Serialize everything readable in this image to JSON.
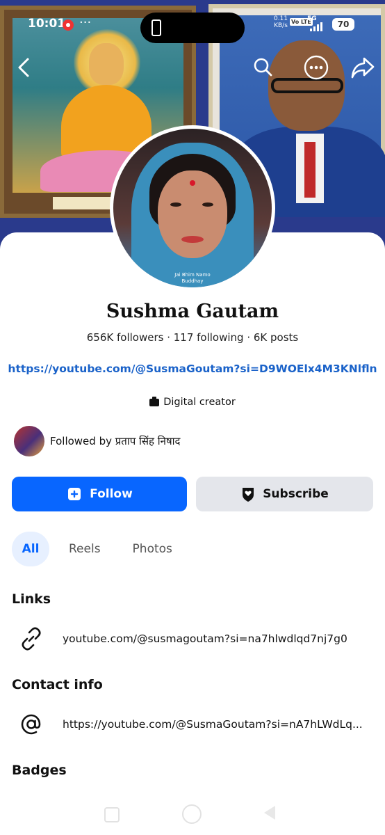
{
  "status_bar": {
    "time": "10:01",
    "more": "···",
    "speed_value": "0.11",
    "speed_unit": "KB/s",
    "volte": "Vo LTE",
    "signal": "5G",
    "battery": "70"
  },
  "profile": {
    "name": "Sushma Gautam",
    "stats": "656K followers · 117 following · 6K posts",
    "link": "https://youtube.com/@SusmaGoutam?si=D9WOElx4M3KNlfln",
    "category": "Digital creator",
    "avatar_caption_line1": "Jai Bhim Namo",
    "avatar_caption_line2": "Buddhay",
    "followed_by": "Followed by प्रताप सिंह निषाद"
  },
  "actions": {
    "follow_label": "Follow",
    "subscribe_label": "Subscribe"
  },
  "tabs": [
    {
      "label": "All",
      "active": true
    },
    {
      "label": "Reels",
      "active": false
    },
    {
      "label": "Photos",
      "active": false
    }
  ],
  "links_section": {
    "title": "Links",
    "items": [
      {
        "icon": "link-icon",
        "text": "youtube.com/@susmagoutam?si=na7hlwdlqd7nj7g0"
      }
    ]
  },
  "contact_section": {
    "title": "Contact info",
    "items": [
      {
        "icon": "at-icon",
        "text": "https://youtube.com/@SusmaGoutam?si=nA7hLWdLq..."
      }
    ]
  },
  "badges_section": {
    "title": "Badges"
  },
  "colors": {
    "accent": "#0866ff",
    "link": "#1a62c9",
    "secondary_button": "#e4e6eb",
    "active_tab_bg": "#e7f0ff"
  }
}
